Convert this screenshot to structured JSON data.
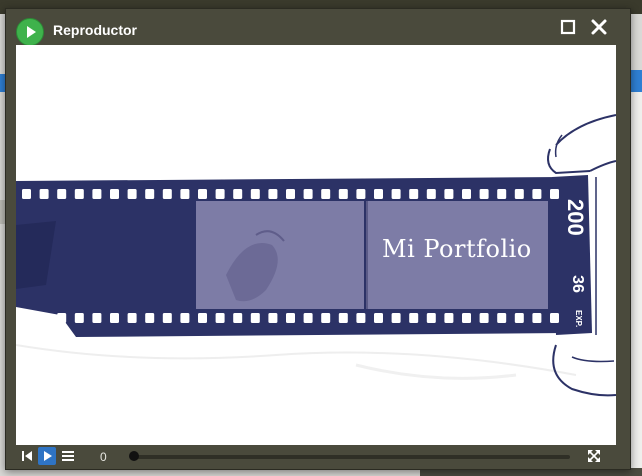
{
  "window": {
    "title": "Reproductor"
  },
  "video": {
    "overlay_text": "Mi Portfolio",
    "film_speed": "200",
    "film_exposures": "36",
    "film_exp_label": "EXP."
  },
  "controls": {
    "time": "0",
    "progress": 0
  },
  "icons": {
    "app": "play-circle-icon",
    "maximize": "maximize-icon",
    "close": "close-icon",
    "prev": "skip-back-icon",
    "play": "play-icon",
    "playlist": "playlist-icon",
    "fullscreen": "fullscreen-icon"
  },
  "colors": {
    "film": "#2c3266",
    "frame": "#7d7ca6",
    "app_icon": "#3fb24c",
    "play_button": "#2f74c4",
    "window": "#4a4a3c"
  }
}
